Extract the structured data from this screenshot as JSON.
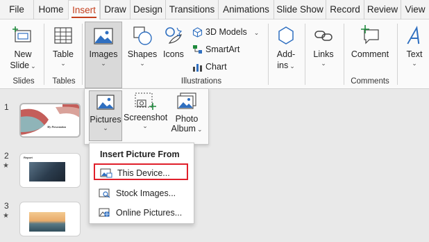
{
  "tabs": [
    {
      "label": "File"
    },
    {
      "label": "Home"
    },
    {
      "label": "Insert",
      "active": true
    },
    {
      "label": "Draw"
    },
    {
      "label": "Design"
    },
    {
      "label": "Transitions"
    },
    {
      "label": "Animations"
    },
    {
      "label": "Slide Show"
    },
    {
      "label": "Record"
    },
    {
      "label": "Review"
    },
    {
      "label": "View"
    }
  ],
  "ribbon": {
    "new_slide": {
      "line1": "New",
      "line2": "Slide"
    },
    "table": "Table",
    "images": "Images",
    "shapes": "Shapes",
    "icons": "Icons",
    "models_3d": "3D Models",
    "smartart": "SmartArt",
    "chart": "Chart",
    "addins": {
      "line1": "Add-",
      "line2": "ins"
    },
    "links": "Links",
    "comment": "Comment",
    "text": "Text",
    "groups": {
      "slides": "Slides",
      "tables": "Tables",
      "illustrations": "Illustrations",
      "comments": "Comments"
    }
  },
  "slides": [
    {
      "number": "1",
      "caption": "My Presentation"
    },
    {
      "number": "2",
      "star": "★",
      "caption": "Report"
    },
    {
      "number": "3",
      "star": "★"
    }
  ],
  "pictures_panel": {
    "pictures": "Pictures",
    "screenshot": "Screenshot",
    "photo_album": {
      "line1": "Photo",
      "line2": "Album"
    }
  },
  "insert_menu": {
    "header": "Insert Picture From",
    "items": [
      {
        "label": "This Device...",
        "icon": "device-picture-icon",
        "highlighted": true
      },
      {
        "label": "Stock Images...",
        "icon": "stock-images-icon"
      },
      {
        "label": "Online Pictures...",
        "icon": "online-pictures-icon"
      }
    ]
  },
  "colors": {
    "accent": "#c43e1c",
    "icon_blue": "#2f6fc0",
    "highlight_red": "#e01f2a"
  }
}
